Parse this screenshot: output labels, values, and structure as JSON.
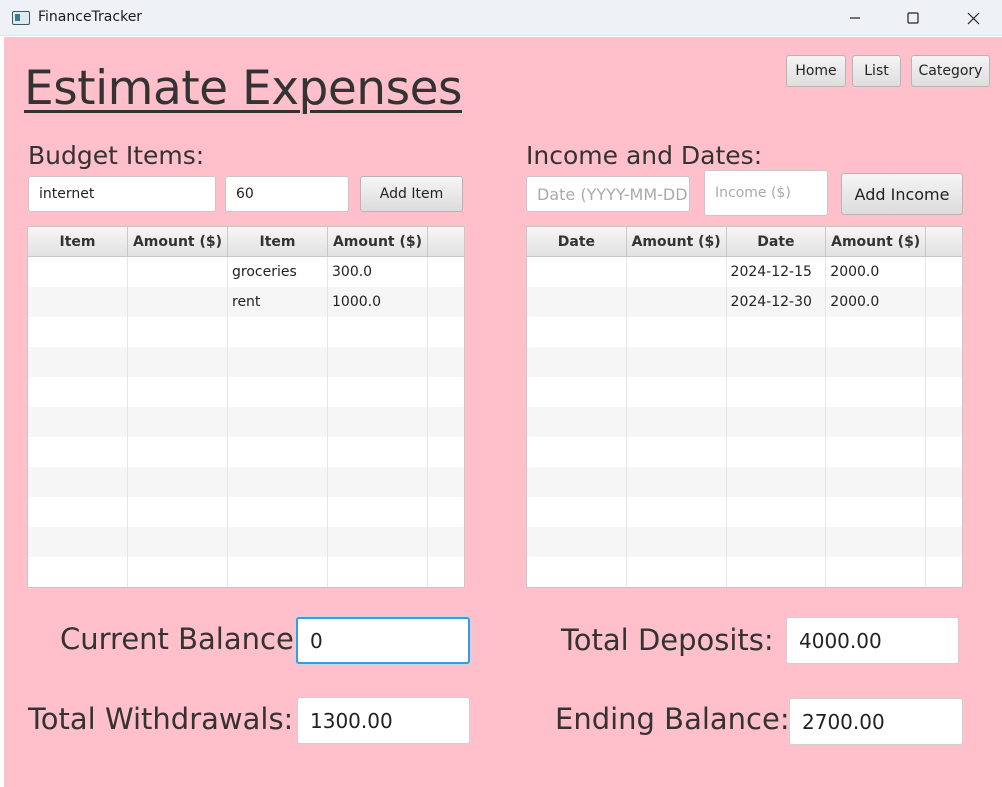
{
  "window": {
    "app_title": "FinanceTracker",
    "controls": [
      "minimize",
      "maximize",
      "close"
    ]
  },
  "page_title": "Estimate Expenses",
  "nav": {
    "home": "Home",
    "list": "List",
    "category": "Category"
  },
  "budget": {
    "label": "Budget Items:",
    "item_input_value": "internet",
    "amount_input_value": "60",
    "add_button": "Add Item",
    "columns": [
      "Item",
      "Amount ($)",
      "Item",
      "Amount ($)"
    ],
    "rows": [
      [
        "",
        "",
        "groceries",
        "300.0"
      ],
      [
        "",
        "",
        "rent",
        "1000.0"
      ]
    ]
  },
  "income": {
    "label": "Income and Dates:",
    "date_placeholder": "Date (YYYY-MM-DD)",
    "income_placeholder": "Income ($)",
    "add_button": "Add Income",
    "columns": [
      "Date",
      "Amount ($)",
      "Date",
      "Amount ($)"
    ],
    "rows": [
      [
        "",
        "",
        "2024-12-15",
        "2000.0"
      ],
      [
        "",
        "",
        "2024-12-30",
        "2000.0"
      ]
    ]
  },
  "summary": {
    "current_balance_label": "Current Balance:",
    "current_balance_value": "0",
    "total_withdrawals_label": "Total Withdrawals:",
    "total_withdrawals_value": "1300.00",
    "total_deposits_label": "Total Deposits:",
    "total_deposits_value": "4000.00",
    "ending_balance_label": "Ending Balance:",
    "ending_balance_value": "2700.00"
  },
  "colors": {
    "background": "#ffc0cb",
    "focus": "#3b9ad9"
  }
}
